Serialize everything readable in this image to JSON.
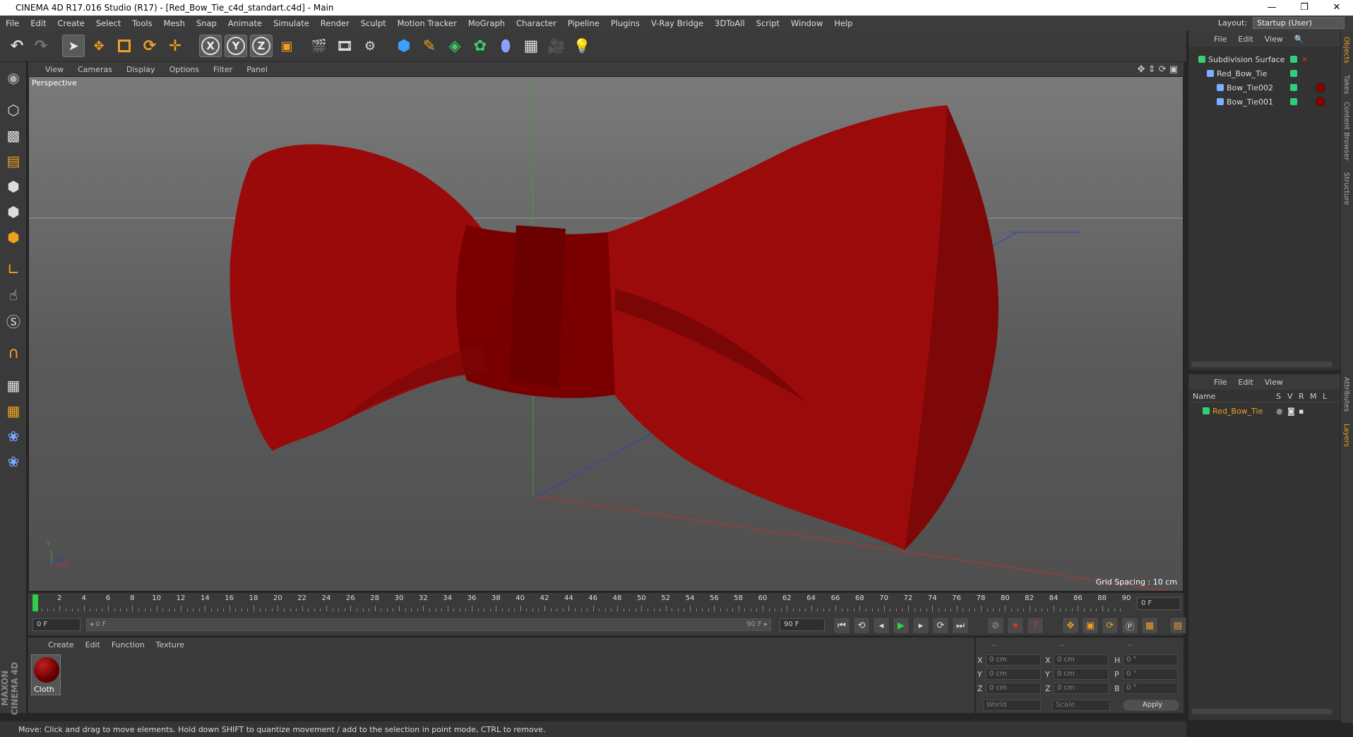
{
  "window": {
    "title": "CINEMA 4D R17.016 Studio (R17) - [Red_Bow_Tie_c4d_standart.c4d] - Main",
    "controls": [
      "—",
      "❐",
      "✕"
    ]
  },
  "menubar": {
    "items": [
      "File",
      "Edit",
      "Create",
      "Select",
      "Tools",
      "Mesh",
      "Snap",
      "Animate",
      "Simulate",
      "Render",
      "Sculpt",
      "Motion Tracker",
      "MoGraph",
      "Character",
      "Pipeline",
      "Plugins",
      "V-Ray Bridge",
      "3DToAll",
      "Script",
      "Window",
      "Help"
    ],
    "layout_label": "Layout:",
    "layout_value": "Startup (User)"
  },
  "toolbar": {
    "axes": [
      "X",
      "Y",
      "Z"
    ]
  },
  "viewport": {
    "menu": [
      "View",
      "Cameras",
      "Display",
      "Options",
      "Filter",
      "Panel"
    ],
    "camera_label": "Perspective",
    "grid_spacing": "Grid Spacing : 10 cm",
    "axis_labels": {
      "y": "Y",
      "x": "X",
      "z": "Z"
    }
  },
  "timeline": {
    "ticks": [
      "0",
      "2",
      "4",
      "6",
      "8",
      "10",
      "12",
      "14",
      "16",
      "18",
      "20",
      "22",
      "24",
      "26",
      "28",
      "30",
      "32",
      "34",
      "36",
      "38",
      "40",
      "42",
      "44",
      "46",
      "48",
      "50",
      "52",
      "54",
      "56",
      "58",
      "60",
      "62",
      "64",
      "66",
      "68",
      "70",
      "72",
      "74",
      "76",
      "78",
      "80",
      "82",
      "84",
      "86",
      "88",
      "90"
    ],
    "current_frame": "0 F"
  },
  "transport": {
    "start": "0 F",
    "range_start": "◂ 0 F",
    "range_end": "90 F ▸",
    "end": "90 F"
  },
  "material_manager": {
    "menu": [
      "Create",
      "Edit",
      "Function",
      "Texture"
    ],
    "materials": [
      {
        "name": "Cloth"
      }
    ]
  },
  "coords": {
    "headers": [
      "--",
      "--",
      "--"
    ],
    "rows": [
      {
        "a": "X",
        "av": "0 cm",
        "b": "X",
        "bv": "0 cm",
        "c": "H",
        "cv": "0 °"
      },
      {
        "a": "Y",
        "av": "0 cm",
        "b": "Y",
        "bv": "0 cm",
        "c": "P",
        "cv": "0 °"
      },
      {
        "a": "Z",
        "av": "0 cm",
        "b": "Z",
        "bv": "0 cm",
        "c": "B",
        "cv": "0 °"
      }
    ],
    "world": "World",
    "scale": "Scale",
    "apply": "Apply"
  },
  "object_manager": {
    "menu": [
      "File",
      "Edit",
      "View"
    ],
    "objects": [
      {
        "name": "Subdivision Surface",
        "indent": 0
      },
      {
        "name": "Red_Bow_Tie",
        "indent": 1
      },
      {
        "name": "Bow_Tie002",
        "indent": 2
      },
      {
        "name": "Bow_Tie001",
        "indent": 2
      }
    ]
  },
  "layer_manager": {
    "menu": [
      "File",
      "Edit",
      "View"
    ],
    "columns": [
      "Name",
      "S",
      "V",
      "R",
      "M",
      "L"
    ],
    "layers": [
      {
        "name": "Red_Bow_Tie"
      }
    ]
  },
  "right_tabs": [
    "Objects",
    "Takes",
    "Content Browser",
    "Structure",
    "Attributes",
    "Layers"
  ],
  "status": "Move: Click and drag to move elements. Hold down SHIFT to quantize movement / add to the selection in point mode, CTRL to remove.",
  "brand": "MAXON CINEMA 4D",
  "colors": {
    "bowtie": "#8a0000",
    "accent": "#f0a020",
    "layer_green": "#2fcf7a"
  }
}
